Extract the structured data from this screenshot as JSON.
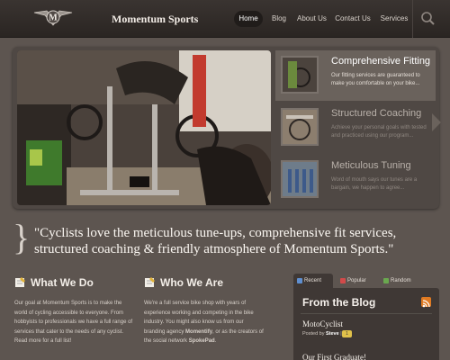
{
  "header": {
    "site_title": "Momentum Sports",
    "logo_letter": "M",
    "nav": [
      {
        "label": "Home",
        "active": true
      },
      {
        "label": "Blog",
        "active": false
      },
      {
        "label": "About Us",
        "active": false
      },
      {
        "label": "Contact Us",
        "active": false
      },
      {
        "label": "Services",
        "active": false
      }
    ],
    "search_icon": "search-icon"
  },
  "slider": {
    "panels": [
      {
        "title": "Comprehensive Fitting",
        "desc": "Our fitting services are guaranteed to make you comfortable on your bike...",
        "state": "active"
      },
      {
        "title": "Structured Coaching",
        "desc": "Achieve your personal goals with tested and practiced using our program...",
        "state": "dim"
      },
      {
        "title": "Meticulous Tuning",
        "desc": "Word of mouth says our tunes are a bargain, we happen to agree...",
        "state": "dim"
      }
    ]
  },
  "quote": {
    "brace": "}",
    "text": "\"Cyclists love the meticulous tune-ups, comprehensive fit services, structured coaching & friendly atmosphere of Momentum Sports.\""
  },
  "columns": {
    "what_we_do": {
      "title": "What We Do",
      "body": "Our goal at Momentum Sports is to make the world of cycling accessible to everyone. From hobbyists to professionals we have a full range of services that cater to the needs of any cyclist. Read more for a full list!"
    },
    "who_we_are": {
      "title": "Who We Are",
      "body_before": "We're a full service bike shop with years of experience working and competing in the bike industry. You might also know us from our branding agency ",
      "agency": "Momentify",
      "body_middle": ", or as the creators of the social network ",
      "network": "SpokePad",
      "body_after": "."
    }
  },
  "sidebar": {
    "tabs": [
      {
        "label": "Recent",
        "active": true,
        "color": "#5f8fd0"
      },
      {
        "label": "Popular",
        "active": false,
        "color": "#d24a4a"
      },
      {
        "label": "Random",
        "active": false,
        "color": "#6aa84f"
      }
    ],
    "blog_title": "From the Blog",
    "posts": [
      {
        "title": "MotoCyclist",
        "meta_prefix": "Posted by",
        "author": "Steve",
        "comments": "1"
      },
      {
        "title": "Our First Graduate!"
      }
    ]
  },
  "colors": {
    "accent": "#6a625c",
    "background": "#5d5550",
    "header": "#2a2522",
    "rss": "#e07a22"
  }
}
